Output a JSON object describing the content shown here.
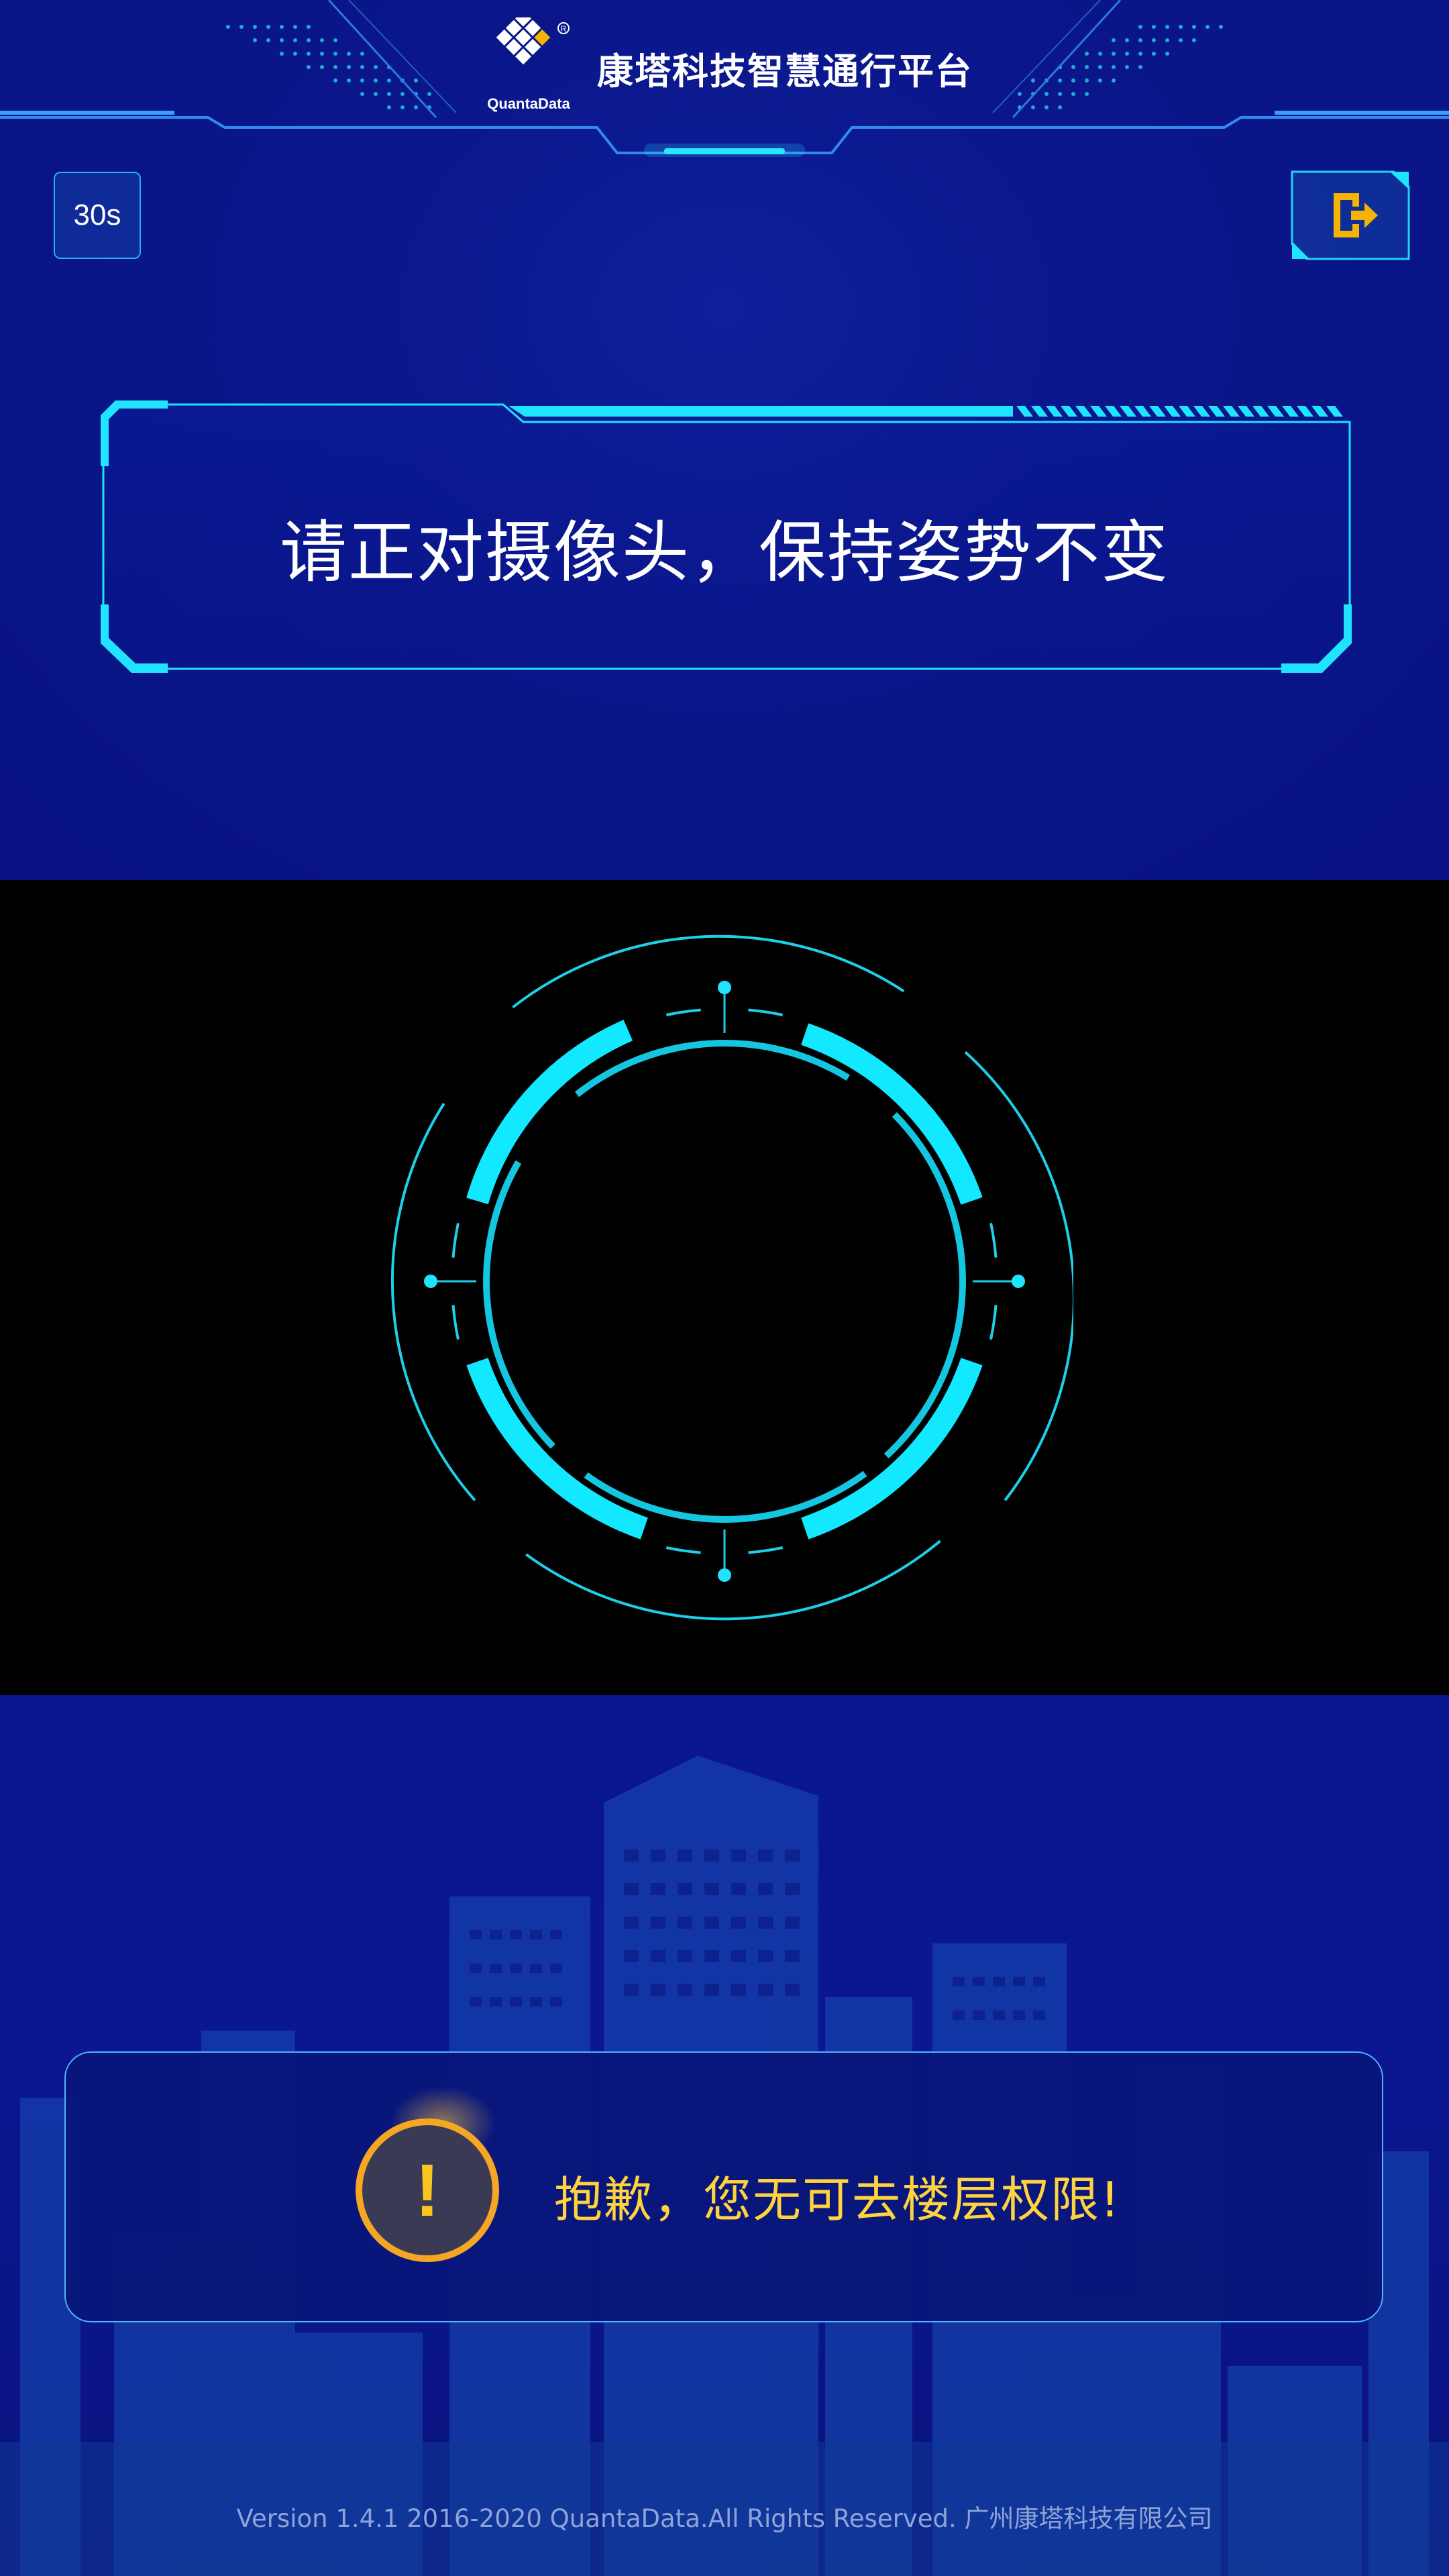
{
  "header": {
    "brand_name": "QuantaData",
    "title": "康塔科技智慧通行平台"
  },
  "countdown": {
    "label": "30s"
  },
  "exit_button": {
    "icon": "exit-icon",
    "color": "#f5b400"
  },
  "prompt": {
    "text": "请正对摄像头，保持姿势不变"
  },
  "alert": {
    "icon": "warning-icon",
    "icon_glyph": "!",
    "message": "抱歉，您无可去楼层权限!",
    "color": "#ffd33d"
  },
  "footer": {
    "text": "Version 1.4.1  2016-2020 QuantaData.All Rights Reserved. 广州康塔科技有限公司"
  },
  "theme": {
    "background": "#081282",
    "accent": "#1fe3ff",
    "camera_background": "#000000"
  }
}
